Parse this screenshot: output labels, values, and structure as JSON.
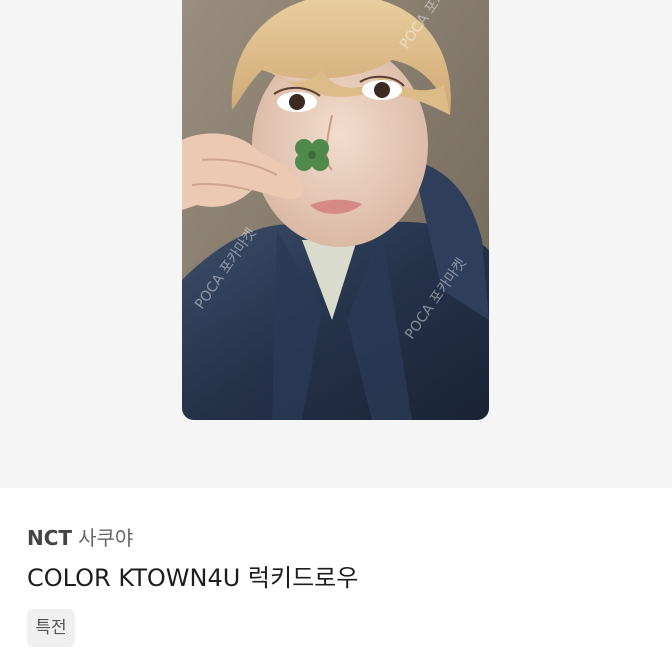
{
  "listing": {
    "image_alt": "photocard",
    "watermark": "POCA 포카마켓",
    "group": "NCT",
    "member": "사쿠야",
    "title": "COLOR KTOWN4U 럭키드로우",
    "tag": "특전"
  },
  "colors": {
    "photo_background": "#f5f5f5",
    "tag_background": "#f0f0f0",
    "text_primary": "#1d1d1d"
  }
}
